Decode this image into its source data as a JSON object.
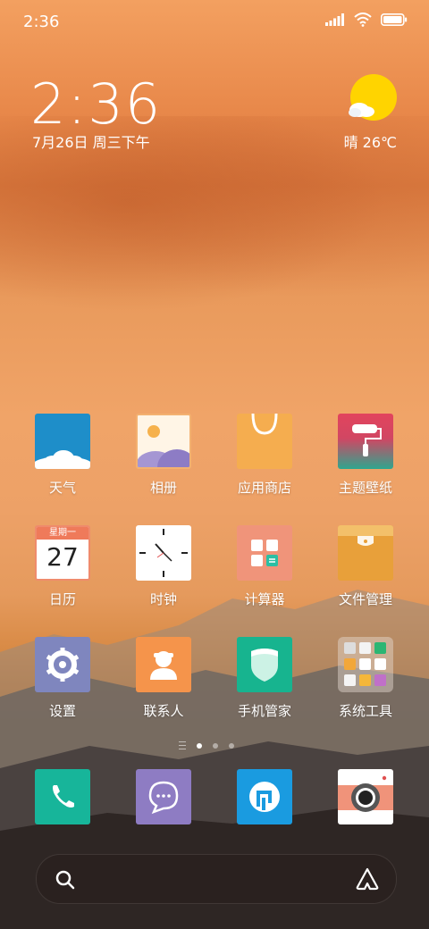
{
  "status_bar": {
    "time": "2:36"
  },
  "clock_widget": {
    "time": "2:36",
    "date": "7月26日 周三下午"
  },
  "weather_widget": {
    "text": "晴 26℃",
    "icon": "sunny-cloud-icon"
  },
  "apps": [
    {
      "label": "天气",
      "icon": "weather-icon"
    },
    {
      "label": "相册",
      "icon": "gallery-icon"
    },
    {
      "label": "应用商店",
      "icon": "app-store-icon"
    },
    {
      "label": "主题壁纸",
      "icon": "theme-icon"
    },
    {
      "label": "日历",
      "icon": "calendar-icon",
      "calendar_header": "星期一",
      "calendar_day": "27"
    },
    {
      "label": "时钟",
      "icon": "clock-icon"
    },
    {
      "label": "计算器",
      "icon": "calculator-icon"
    },
    {
      "label": "文件管理",
      "icon": "folder-icon"
    },
    {
      "label": "设置",
      "icon": "settings-icon"
    },
    {
      "label": "联系人",
      "icon": "contacts-icon"
    },
    {
      "label": "手机管家",
      "icon": "security-icon"
    },
    {
      "label": "系统工具",
      "icon": "folder-tools-icon"
    }
  ],
  "page_indicator": {
    "pages": 3,
    "active": 1
  },
  "dock": [
    {
      "icon": "phone-icon",
      "color": "#17b59a"
    },
    {
      "icon": "messages-icon",
      "color": "#8e7cc3"
    },
    {
      "icon": "browser-icon",
      "color": "#1a9be0"
    },
    {
      "icon": "camera-icon",
      "color": "#f0937a"
    }
  ],
  "colors": {
    "weather_tile": "#1e8ec9",
    "settings_tile": "#7f86be",
    "contacts_tile": "#f5944b",
    "security_tile": "#17b48f",
    "calc_tile": "#f0947a",
    "folder_tile": "#e8a03a"
  }
}
